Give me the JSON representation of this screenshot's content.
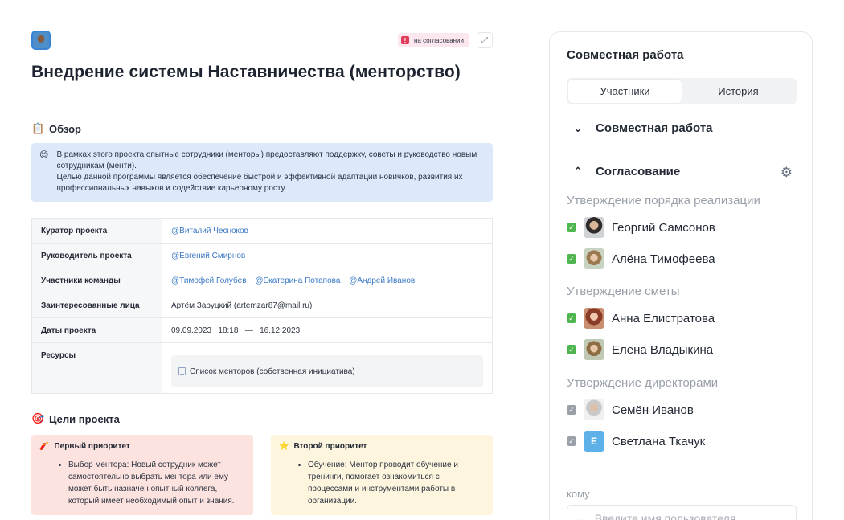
{
  "doc": {
    "status_badge": "на согласовании",
    "status_mark": "!",
    "expand_glyph": "⤢",
    "title": "Внедрение системы Наставничества (менторство)",
    "overview": {
      "emoji": "📋",
      "heading": "Обзор",
      "note_emoji": "😊",
      "note_line1": "В рамках этого проекта опытные сотрудники (менторы) предоставляют поддержку, советы и руководство новым сотрудникам (менти).",
      "note_line2": "Целью данной программы является обеспечение быстрой и эффективной адаптации новичков, развития их профессиональных навыков и содействие карьерному росту."
    },
    "table": {
      "curator_label": "Куратор проекта",
      "curator": "@Виталий Чесноков",
      "lead_label": "Руководитель проекта",
      "lead": "@Евгений Смирнов",
      "team_label": "Участники команды",
      "team": [
        "@Тимофей Голубев",
        "@Екатерина Потапова",
        "@Андрей Иванов"
      ],
      "stakeholders_label": "Заинтересованные лица",
      "stakeholders": "Артём Заруцкий (artemzar87@mail.ru)",
      "dates_label": "Даты проекта",
      "dates": "09.09.2023   18:18   —   16.12.2023",
      "resources_label": "Ресурсы",
      "resource_item": "Список менторов (собственная инициатива)"
    },
    "goals": {
      "emoji": "🎯",
      "heading": "Цели проекта",
      "first": {
        "emoji": "🧨",
        "title": "Первый приоритет",
        "text": "Выбор ментора: Новый сотрудник может самостоятельно выбрать ментора или ему может быть назначен опытный коллега, который имеет необходимый опыт и знания."
      },
      "second": {
        "emoji": "⭐",
        "title": "Второй приоритет",
        "text": "Обучение: Ментор проводит обучение и тренинги, помогает ознакомиться с процессами и инструментами работы в организации."
      }
    }
  },
  "panel": {
    "title": "Совместная работа",
    "tabs": [
      "Участники",
      "История"
    ],
    "collab_section": "Совместная работа",
    "approval_section": "Согласование",
    "chevron_down": "⌄",
    "chevron_up": "⌃",
    "gear": "⚙",
    "check": "✓",
    "groups": [
      {
        "label": "Утверждение порядка реализации",
        "people": [
          {
            "name": "Георгий Самсонов",
            "checked": "green"
          },
          {
            "name": "Алёна Тимофеева",
            "checked": "green"
          }
        ]
      },
      {
        "label": "Утверждение сметы",
        "people": [
          {
            "name": "Анна Елистратова",
            "checked": "green"
          },
          {
            "name": "Елена Владыкина",
            "checked": "green"
          }
        ]
      },
      {
        "label": "Утверждение директорами",
        "people": [
          {
            "name": "Семён Иванов",
            "checked": "grey"
          },
          {
            "name": "Светлана Ткачук",
            "checked": "grey",
            "initial": "Е"
          }
        ]
      }
    ],
    "to_label": "кому",
    "input_placeholder": "Введите имя пользователя"
  },
  "colors": {
    "accent_green": "#4fb54e",
    "link_blue": "#3a78c4",
    "badge_red": "#e23b57"
  }
}
